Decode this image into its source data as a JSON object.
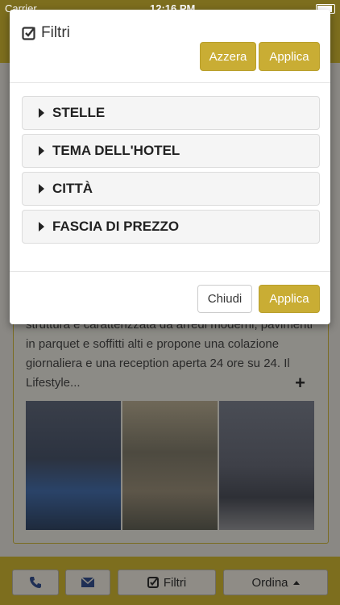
{
  "status_bar": {
    "carrier": "Carrier",
    "time": "12:16 PM"
  },
  "modal": {
    "title": "Filtri",
    "reset_label": "Azzera",
    "apply_top_label": "Applica",
    "sections": [
      {
        "label": "STELLE"
      },
      {
        "label": "TEMA DELL'HOTEL"
      },
      {
        "label": "CITTÀ"
      },
      {
        "label": "FASCIA DI PREZZO"
      }
    ],
    "close_label": "Chiudi",
    "apply_bottom_label": "Applica"
  },
  "card": {
    "description": "struttura è caratterizzata da arredi moderni, pavimenti in parquet e soffitti alti e propone una colazione giornaliera e una reception aperta 24 ore su 24. Il Lifestyle...",
    "expand_symbol": "+"
  },
  "bottom_bar": {
    "filters_label": "Filtri",
    "sort_label": "Ordina"
  },
  "icons": {
    "check": "check-square-icon",
    "phone": "phone-icon",
    "mail": "mail-icon",
    "sort_caret": "caret-up-icon"
  },
  "colors": {
    "accent": "#c9ad34",
    "header": "#7d6e1e"
  }
}
